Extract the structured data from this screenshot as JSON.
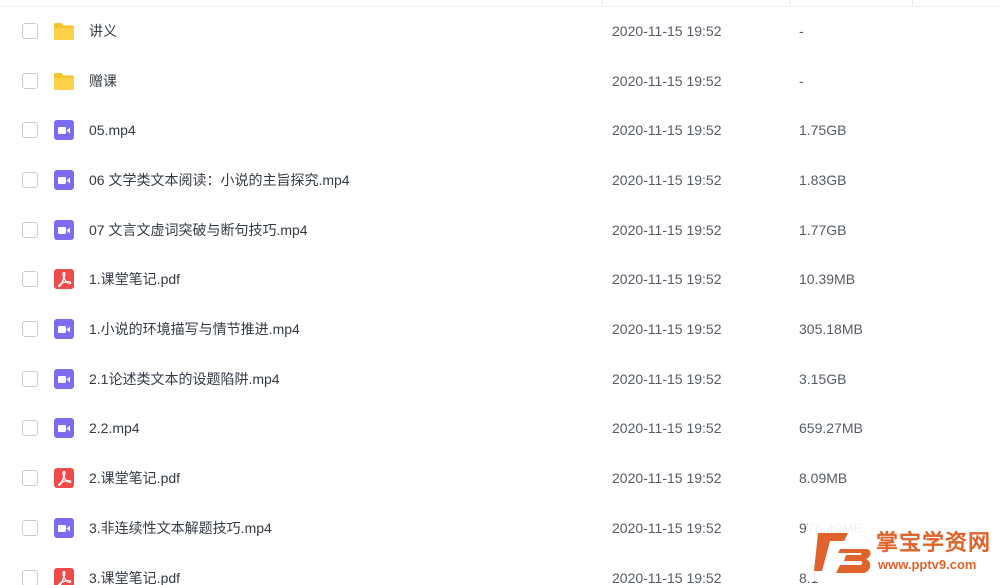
{
  "files": [
    {
      "name": "讲义",
      "date": "2020-11-15 19:52",
      "size": "-",
      "type": "folder",
      "icon": "folder-icon"
    },
    {
      "name": "赠课",
      "date": "2020-11-15 19:52",
      "size": "-",
      "type": "folder",
      "icon": "folder-icon"
    },
    {
      "name": "05.mp4",
      "date": "2020-11-15 19:52",
      "size": "1.75GB",
      "type": "video",
      "icon": "video-file-icon"
    },
    {
      "name": "06 文学类文本阅读：小说的主旨探究.mp4",
      "date": "2020-11-15 19:52",
      "size": "1.83GB",
      "type": "video",
      "icon": "video-file-icon"
    },
    {
      "name": "07 文言文虚词突破与断句技巧.mp4",
      "date": "2020-11-15 19:52",
      "size": "1.77GB",
      "type": "video",
      "icon": "video-file-icon"
    },
    {
      "name": "1.课堂笔记.pdf",
      "date": "2020-11-15 19:52",
      "size": "10.39MB",
      "type": "pdf",
      "icon": "pdf-file-icon"
    },
    {
      "name": "1.小说的环境描写与情节推进.mp4",
      "date": "2020-11-15 19:52",
      "size": "305.18MB",
      "type": "video",
      "icon": "video-file-icon"
    },
    {
      "name": "2.1论述类文本的设题陷阱.mp4",
      "date": "2020-11-15 19:52",
      "size": "3.15GB",
      "type": "video",
      "icon": "video-file-icon"
    },
    {
      "name": "2.2.mp4",
      "date": "2020-11-15 19:52",
      "size": "659.27MB",
      "type": "video",
      "icon": "video-file-icon"
    },
    {
      "name": "2.课堂笔记.pdf",
      "date": "2020-11-15 19:52",
      "size": "8.09MB",
      "type": "pdf",
      "icon": "pdf-file-icon"
    },
    {
      "name": "3.非连续性文本解题技巧.mp4",
      "date": "2020-11-15 19:52",
      "size": "976.49MB",
      "type": "video",
      "icon": "video-file-icon"
    },
    {
      "name": "3.课堂笔记.pdf",
      "date": "2020-11-15 19:52",
      "size": "8.1",
      "type": "pdf",
      "icon": "pdf-file-icon"
    }
  ],
  "colors": {
    "folder": "#f7c32e",
    "video": "#7b6cf0",
    "pdf": "#ef4b4b",
    "watermark": "#e0632c"
  },
  "watermark": {
    "name": "掌宝学资网",
    "url": "www.pptv9.com"
  }
}
